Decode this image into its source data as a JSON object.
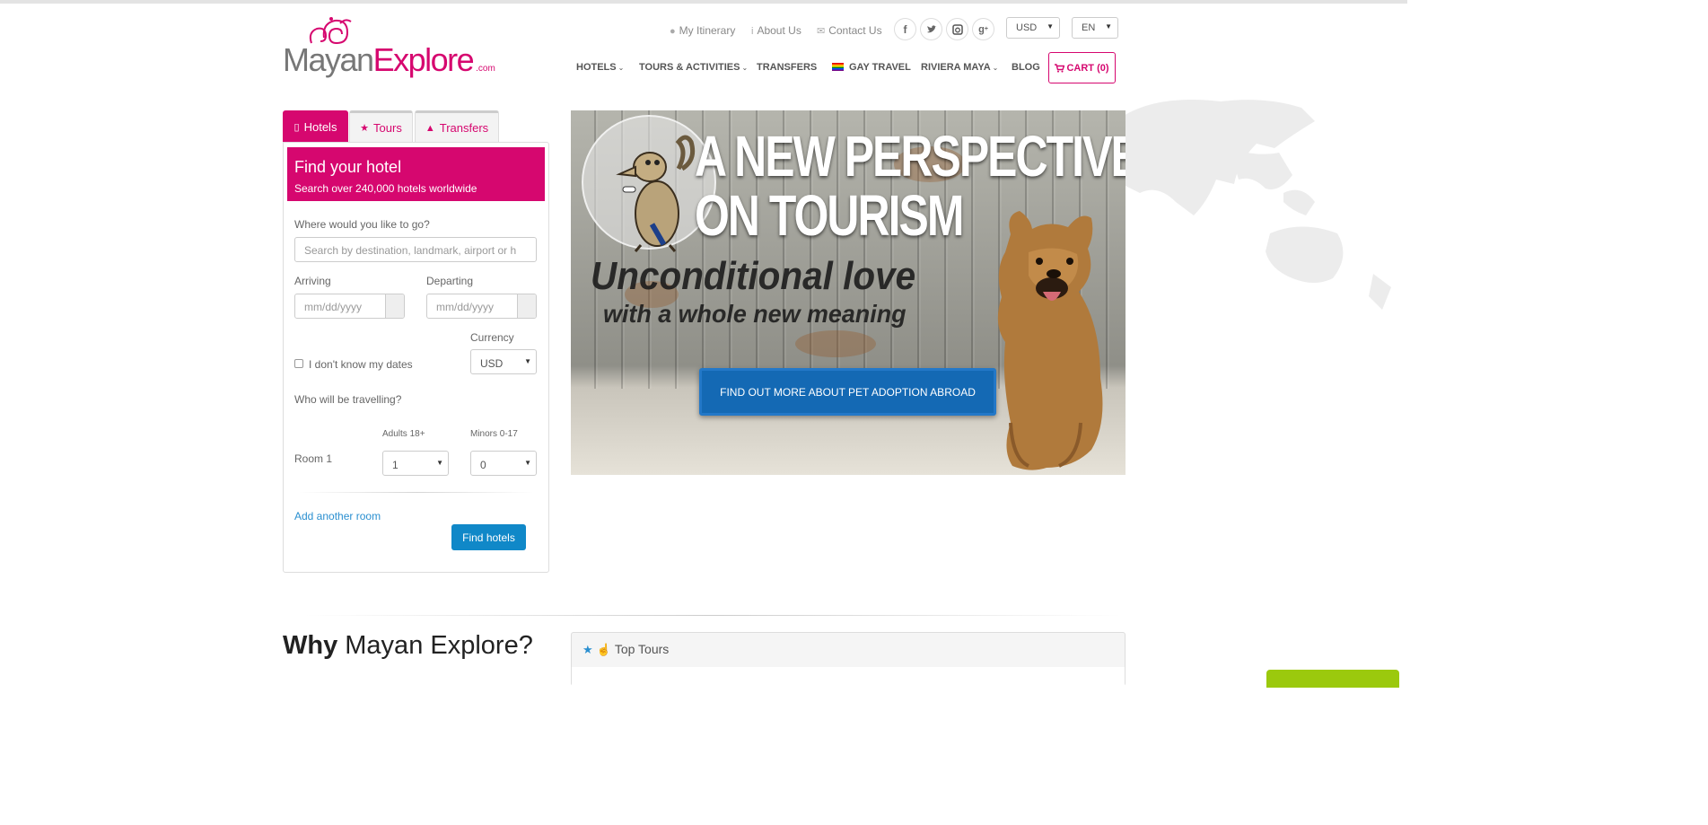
{
  "logo": {
    "part1": "Mayan",
    "part2": "Explore",
    "tld": ".com"
  },
  "utility": {
    "itinerary": "My Itinerary",
    "about": "About Us",
    "contact": "Contact Us"
  },
  "social": [
    "f",
    "t",
    "ig",
    "g+"
  ],
  "top_selects": {
    "currency": "USD",
    "language": "EN"
  },
  "nav": {
    "hotels": "HOTELS",
    "tours": "TOURS & ACTIVITIES",
    "transfers": "TRANSFERS",
    "gay": "GAY TRAVEL",
    "riviera": "RIVIERA MAYA",
    "blog": "BLOG",
    "cart": "CART (0)"
  },
  "tabs": {
    "hotels": "Hotels",
    "tours": "Tours",
    "transfers": "Transfers"
  },
  "search": {
    "title": "Find your hotel",
    "subtitle": "Search over 240,000 hotels worldwide",
    "where_label": "Where would you like to go?",
    "where_placeholder": "Search by destination, landmark, airport or h",
    "arriving_label": "Arriving",
    "arriving_placeholder": "mm/dd/yyyy",
    "departing_label": "Departing",
    "departing_placeholder": "mm/dd/yyyy",
    "currency_label": "Currency",
    "currency_value": "USD",
    "no_dates": "I don't know my dates",
    "who_label": "Who will be travelling?",
    "adults_label": "Adults 18+",
    "minors_label": "Minors 0-17",
    "room_label": "Room 1",
    "adults_value": "1",
    "minors_value": "0",
    "add_room": "Add another room",
    "find_button": "Find hotels"
  },
  "banner": {
    "headline1": "A NEW PERSPECTIVE",
    "headline2": "ON TOURISM",
    "love1": "Unconditional love",
    "love2": "with a whole new meaning",
    "cta": "FIND OUT MORE ABOUT PET ADOPTION ABROAD"
  },
  "bottom": {
    "why_bold": "Why",
    "why_rest": " Mayan Explore?",
    "top_tours": "Top Tours"
  },
  "colors": {
    "brand": "#d6076f",
    "button_blue": "#1088c8",
    "banner_button": "#1469b4"
  }
}
